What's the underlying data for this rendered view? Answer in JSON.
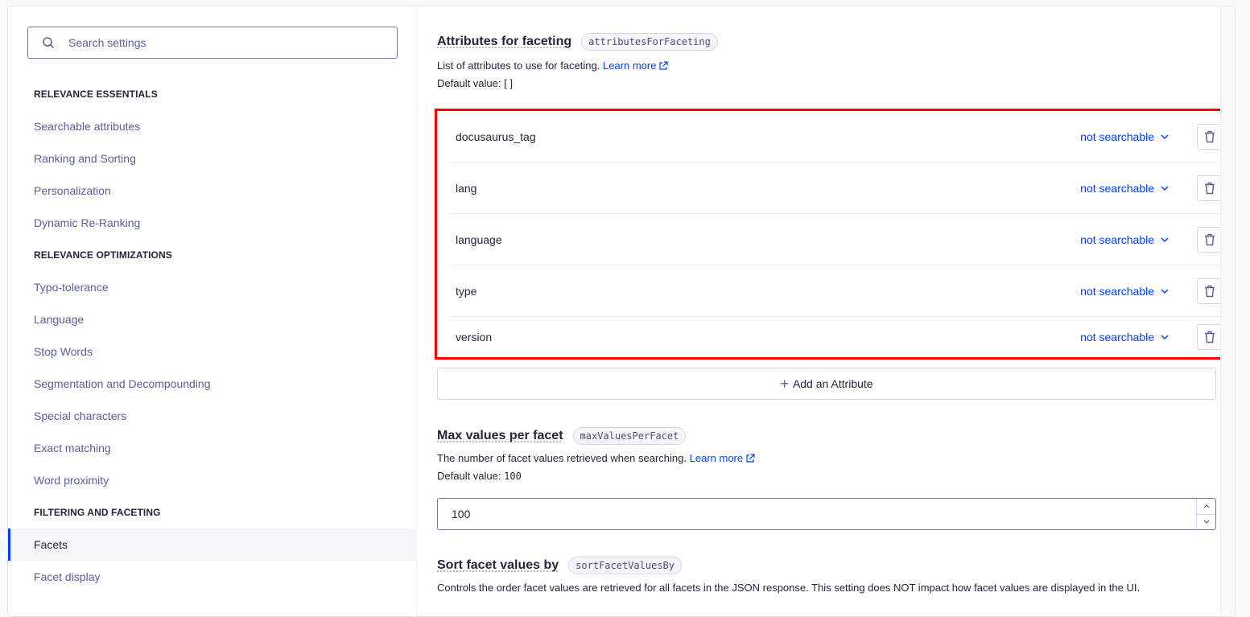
{
  "search": {
    "placeholder": "Search settings",
    "icon": "search-icon"
  },
  "sidebar": {
    "groups": [
      {
        "heading": "RELEVANCE ESSENTIALS",
        "items": [
          "Searchable attributes",
          "Ranking and Sorting",
          "Personalization",
          "Dynamic Re-Ranking"
        ]
      },
      {
        "heading": "RELEVANCE OPTIMIZATIONS",
        "items": [
          "Typo-tolerance",
          "Language",
          "Stop Words",
          "Segmentation and Decompounding",
          "Special characters",
          "Exact matching",
          "Word proximity"
        ]
      },
      {
        "heading": "FILTERING AND FACETING",
        "items": [
          "Facets",
          "Facet display"
        ]
      }
    ],
    "active_item": "Facets"
  },
  "attributes_for_faceting": {
    "title": "Attributes for faceting",
    "code": "attributesForFaceting",
    "description": "List of attributes to use for faceting.",
    "learn_more": "Learn more",
    "default_label": "Default value:",
    "default_value": "[ ]",
    "attributes": [
      {
        "name": "docusaurus_tag",
        "mode": "not searchable"
      },
      {
        "name": "lang",
        "mode": "not searchable"
      },
      {
        "name": "language",
        "mode": "not searchable"
      },
      {
        "name": "type",
        "mode": "not searchable"
      },
      {
        "name": "version",
        "mode": "not searchable"
      }
    ],
    "add_label": "Add an Attribute"
  },
  "max_values_per_facet": {
    "title": "Max values per facet",
    "code": "maxValuesPerFacet",
    "description": "The number of facet values retrieved when searching.",
    "learn_more": "Learn more",
    "default_label": "Default value:",
    "default_value": "100",
    "value": "100"
  },
  "sort_facet_values_by": {
    "title": "Sort facet values by",
    "code": "sortFacetValuesBy",
    "description": "Controls the order facet values are retrieved for all facets in the JSON response. This setting does NOT impact how facet values are displayed in the UI."
  },
  "colors": {
    "accent": "#003dff",
    "highlight_border": "#ff0000",
    "nav_text": "#5a5e9a"
  }
}
